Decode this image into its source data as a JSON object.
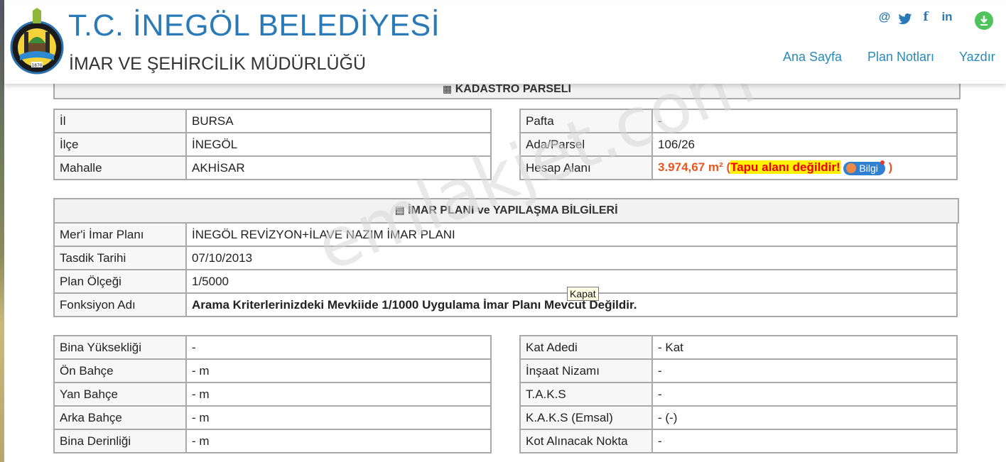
{
  "header": {
    "title": "T.C. İNEGÖL BELEDİYESİ",
    "subtitle": "İMAR VE ŞEHİRCİLİK MÜDÜRLÜĞÜ",
    "logo_year": "1870",
    "social_icons": [
      "at-icon",
      "twitter-icon",
      "facebook-icon",
      "linkedin-icon",
      "download-icon"
    ],
    "nav": [
      "Ana Sayfa",
      "Plan Notları",
      "Yazdır"
    ],
    "accent_color": "#2a7ab8"
  },
  "kadastro": {
    "heading": "KADASTRO PARSELİ",
    "left": [
      {
        "label": "İl",
        "value": "BURSA"
      },
      {
        "label": "İlçe",
        "value": "İNEGÖL"
      },
      {
        "label": "Mahalle",
        "value": "AKHİSAR"
      }
    ],
    "right": [
      {
        "label": "Pafta",
        "value": "-"
      },
      {
        "label": "Ada/Parsel",
        "value": "106/26"
      }
    ],
    "hesap": {
      "label": "Hesap Alanı",
      "area": "3.974,67 m²",
      "open_paren": "(",
      "warning": "Tapu alanı değildir!",
      "button": "Bilgi",
      "close_paren": ")"
    }
  },
  "imar": {
    "heading": "İMAR PLANI ve YAPILAŞMA BİLGİLERİ",
    "rows": [
      {
        "label": "Mer'i İmar Planı",
        "value": "İNEGÖL REVİZYON+İLAVE NAZIM İMAR PLANI"
      },
      {
        "label": "Tasdik Tarihi",
        "value": "07/10/2013"
      },
      {
        "label": "Plan Ölçeği",
        "value": "1/5000"
      },
      {
        "label": "Fonksiyon Adı",
        "value": "Arama Kriterlerinizdeki Mevkiide 1/1000 Uygulama İmar Planı Mevcut Değildir."
      }
    ]
  },
  "yapilasma": {
    "left": [
      {
        "label": "Bina Yüksekliği",
        "value": "-"
      },
      {
        "label": "Ön Bahçe",
        "value": "- m"
      },
      {
        "label": "Yan Bahçe",
        "value": "- m"
      },
      {
        "label": "Arka Bahçe",
        "value": "- m"
      },
      {
        "label": "Bina Derinliği",
        "value": "- m"
      }
    ],
    "right": [
      {
        "label": "Kat Adedi",
        "value": "- Kat"
      },
      {
        "label": "İnşaat Nizamı",
        "value": "-"
      },
      {
        "label": "T.A.K.S",
        "value": "-"
      },
      {
        "label": "K.A.K.S (Emsal)",
        "value": "- (-)"
      },
      {
        "label": "Kot Alınacak Nokta",
        "value": "-"
      }
    ]
  },
  "tooltip": "Kapat",
  "watermark": "emlakjet.com"
}
